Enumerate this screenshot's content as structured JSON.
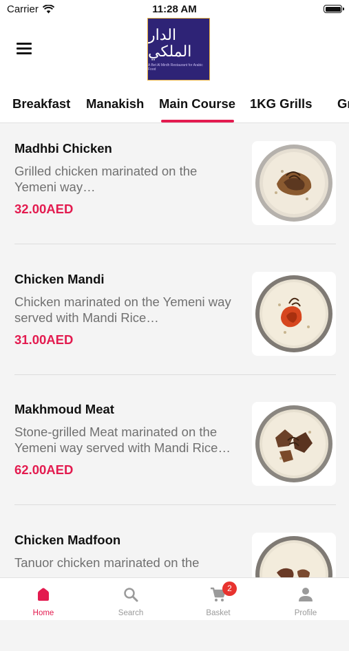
{
  "status_bar": {
    "carrier": "Carrier",
    "time": "11:28 AM"
  },
  "header": {
    "logo_text": "الدار الملكي",
    "logo_subtitle": "A Bet Al Mirdh Restaurant for Arabic Food"
  },
  "tabs": [
    {
      "label": "Breakfast"
    },
    {
      "label": "Manakish"
    },
    {
      "label": "Main Course"
    },
    {
      "label": "1KG Grills"
    },
    {
      "label": "Gr"
    }
  ],
  "active_tab": "Main Course",
  "items": [
    {
      "name": "Madhbi Chicken",
      "description": "Grilled chicken marinated on the Yemeni way…",
      "price": "32.00AED"
    },
    {
      "name": "Chicken Mandi",
      "description": "Chicken marinated on the Yemeni way served with Mandi Rice…",
      "price": "31.00AED"
    },
    {
      "name": "Makhmoud Meat",
      "description": "Stone-grilled Meat marinated on the Yemeni way served with Mandi Rice…",
      "price": "62.00AED"
    },
    {
      "name": "Chicken Madfoon",
      "description": "Tanuor chicken marinated on the",
      "price": ""
    }
  ],
  "bottom_nav": [
    {
      "label": "Home",
      "icon": "home-icon",
      "active": true
    },
    {
      "label": "Search",
      "icon": "search-icon"
    },
    {
      "label": "Basket",
      "icon": "cart-icon",
      "badge": "2"
    },
    {
      "label": "Profile",
      "icon": "person-icon"
    }
  ],
  "colors": {
    "accent": "#e31b4f",
    "badge": "#e8332f",
    "logo_bg": "#2e2376"
  }
}
